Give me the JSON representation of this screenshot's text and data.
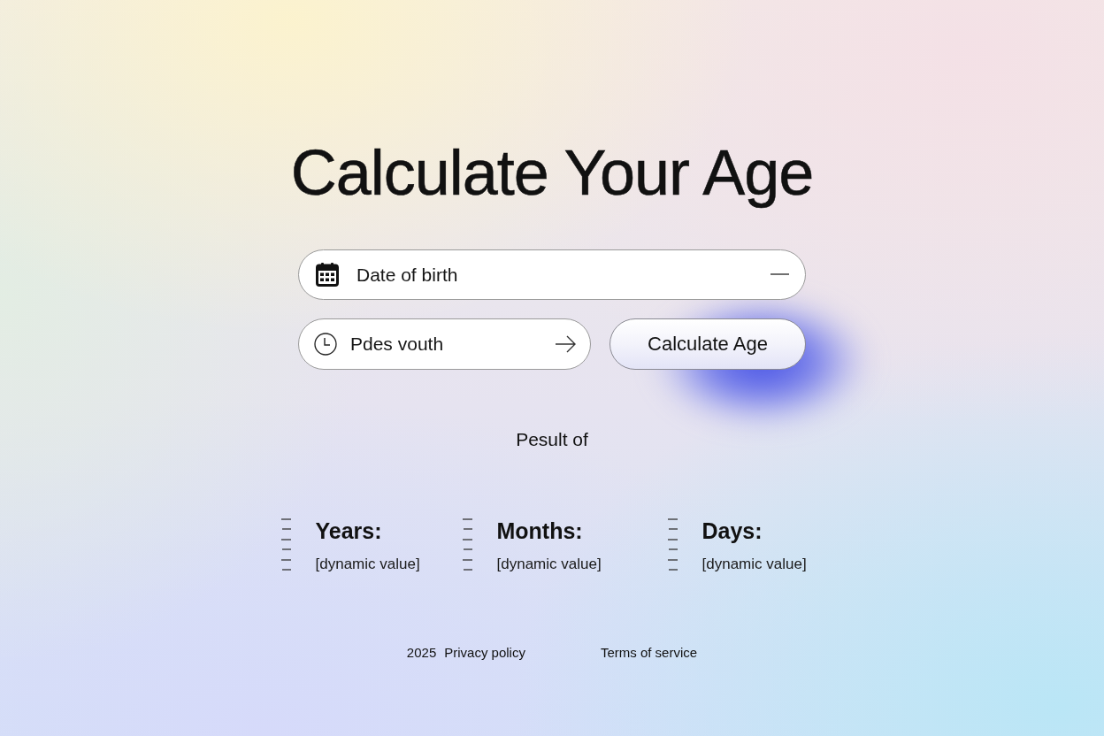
{
  "title": "Calculate Your Age",
  "birth_field": {
    "placeholder": "Date of birth"
  },
  "second_field": {
    "placeholder": "Pdes vouth"
  },
  "calculate_button": {
    "label": "Calculate Age"
  },
  "result_heading": "Pesult of",
  "results": [
    {
      "label": "Years:",
      "value": "[dynamic value]"
    },
    {
      "label": "Months:",
      "value": "[dynamic value]"
    },
    {
      "label": "Days:",
      "value": "[dynamic value]"
    }
  ],
  "footer": {
    "year": "2025",
    "links": [
      "Privacy policy",
      "Terms of service"
    ]
  }
}
